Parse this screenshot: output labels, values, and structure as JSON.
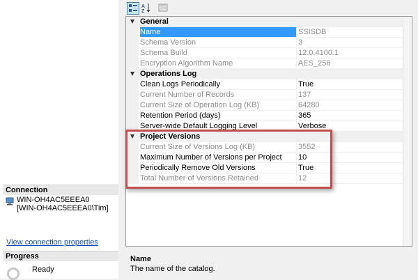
{
  "left": {
    "connection": {
      "header": "Connection",
      "server": "WIN-OH4AC5EEEA0",
      "user": "[WIN-OH4AC5EEEA0\\Tim]"
    },
    "view_link": "View connection properties",
    "progress": {
      "header": "Progress",
      "status": "Ready"
    }
  },
  "toolbar": {
    "categorized_icon": "categorized-icon",
    "alphabetical_icon": "alphabetical-icon",
    "pages_icon": "property-pages-icon"
  },
  "grid": {
    "general": {
      "label": "General",
      "rows": [
        {
          "name": "Name",
          "value": "SSISDB"
        },
        {
          "name": "Schema Version",
          "value": "3"
        },
        {
          "name": "Schema Build",
          "value": "12.0.4100.1"
        },
        {
          "name": "Encryption Algorithm Name",
          "value": "AES_256"
        }
      ]
    },
    "ops": {
      "label": "Operations Log",
      "rows": [
        {
          "name": "Clean Logs Periodically",
          "value": "True"
        },
        {
          "name": "Current Number of Records",
          "value": "137"
        },
        {
          "name": "Current Size of Operation Log (KB)",
          "value": "64280"
        },
        {
          "name": "Retention Period (days)",
          "value": "365"
        },
        {
          "name": "Server-wide Default Logging Level",
          "value": "Verbose"
        }
      ]
    },
    "versions": {
      "label": "Project Versions",
      "rows": [
        {
          "name": "Current Size of Versions Log (KB)",
          "value": "3552"
        },
        {
          "name": "Maximum Number of Versions per Project",
          "value": "10"
        },
        {
          "name": "Periodically Remove Old Versions",
          "value": "True"
        },
        {
          "name": "Total Number of Versions Retained",
          "value": "12"
        }
      ]
    }
  },
  "description": {
    "title": "Name",
    "text": "The name of the catalog."
  },
  "colors": {
    "selection": "#3399ff",
    "highlight_border": "#c0504d",
    "link": "#0b4cc2"
  }
}
